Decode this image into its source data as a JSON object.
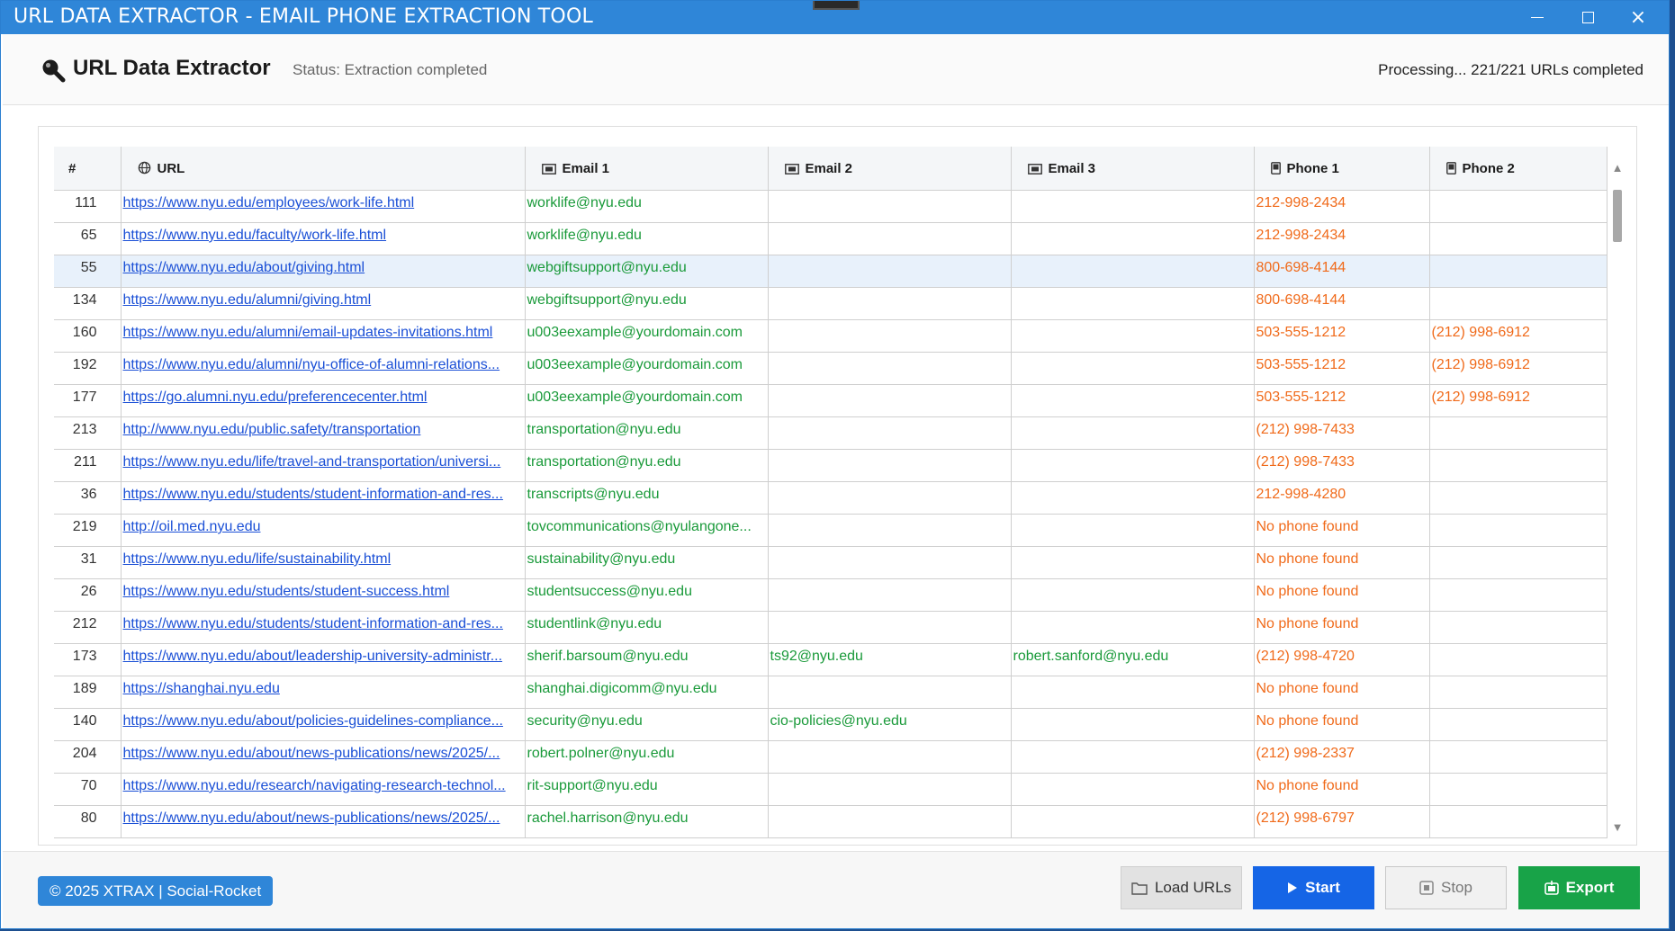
{
  "window": {
    "title": "URL DATA EXTRACTOR - EMAIL  PHONE EXTRACTION TOOL"
  },
  "header": {
    "app_name": "URL Data Extractor",
    "status": "Status: Extraction completed",
    "progress": "Processing... 221/221 URLs completed"
  },
  "table": {
    "columns": [
      "#",
      "URL",
      "Email 1",
      "Email 2",
      "Email 3",
      "Phone 1",
      "Phone 2"
    ],
    "rows": [
      {
        "num": "111",
        "url": "https://www.nyu.edu/employees/work-life.html",
        "email1": "worklife@nyu.edu",
        "email2": "",
        "email3": "",
        "phone1": "212-998-2434",
        "phone2": ""
      },
      {
        "num": "65",
        "url": "https://www.nyu.edu/faculty/work-life.html",
        "email1": "worklife@nyu.edu",
        "email2": "",
        "email3": "",
        "phone1": "212-998-2434",
        "phone2": ""
      },
      {
        "num": "55",
        "url": "https://www.nyu.edu/about/giving.html",
        "email1": "webgiftsupport@nyu.edu",
        "email2": "",
        "email3": "",
        "phone1": "800-698-4144",
        "phone2": ""
      },
      {
        "num": "134",
        "url": "https://www.nyu.edu/alumni/giving.html",
        "email1": "webgiftsupport@nyu.edu",
        "email2": "",
        "email3": "",
        "phone1": "800-698-4144",
        "phone2": ""
      },
      {
        "num": "160",
        "url": "https://www.nyu.edu/alumni/email-updates-invitations.html",
        "email1": "u003eexample@yourdomain.com",
        "email2": "",
        "email3": "",
        "phone1": "503-555-1212",
        "phone2": "(212) 998-6912"
      },
      {
        "num": "192",
        "url": "https://www.nyu.edu/alumni/nyu-office-of-alumni-relations...",
        "email1": "u003eexample@yourdomain.com",
        "email2": "",
        "email3": "",
        "phone1": "503-555-1212",
        "phone2": "(212) 998-6912"
      },
      {
        "num": "177",
        "url": "https://go.alumni.nyu.edu/preferencecenter.html",
        "email1": "u003eexample@yourdomain.com",
        "email2": "",
        "email3": "",
        "phone1": "503-555-1212",
        "phone2": "(212) 998-6912"
      },
      {
        "num": "213",
        "url": "http://www.nyu.edu/public.safety/transportation",
        "email1": "transportation@nyu.edu",
        "email2": "",
        "email3": "",
        "phone1": "(212) 998-7433",
        "phone2": ""
      },
      {
        "num": "211",
        "url": "https://www.nyu.edu/life/travel-and-transportation/universi...",
        "email1": "transportation@nyu.edu",
        "email2": "",
        "email3": "",
        "phone1": "(212) 998-7433",
        "phone2": ""
      },
      {
        "num": "36",
        "url": "https://www.nyu.edu/students/student-information-and-res...",
        "email1": "transcripts@nyu.edu",
        "email2": "",
        "email3": "",
        "phone1": "212-998-4280",
        "phone2": ""
      },
      {
        "num": "219",
        "url": "http://oil.med.nyu.edu",
        "email1": "tovcommunications@nyulangone...",
        "email2": "",
        "email3": "",
        "phone1": "No phone found",
        "phone2": ""
      },
      {
        "num": "31",
        "url": "https://www.nyu.edu/life/sustainability.html",
        "email1": "sustainability@nyu.edu",
        "email2": "",
        "email3": "",
        "phone1": "No phone found",
        "phone2": ""
      },
      {
        "num": "26",
        "url": "https://www.nyu.edu/students/student-success.html",
        "email1": "studentsuccess@nyu.edu",
        "email2": "",
        "email3": "",
        "phone1": "No phone found",
        "phone2": ""
      },
      {
        "num": "212",
        "url": "https://www.nyu.edu/students/student-information-and-res...",
        "email1": "studentlink@nyu.edu",
        "email2": "",
        "email3": "",
        "phone1": "No phone found",
        "phone2": ""
      },
      {
        "num": "173",
        "url": "https://www.nyu.edu/about/leadership-university-administr...",
        "email1": "sherif.barsoum@nyu.edu",
        "email2": "ts92@nyu.edu",
        "email3": "robert.sanford@nyu.edu",
        "phone1": "(212) 998-4720",
        "phone2": ""
      },
      {
        "num": "189",
        "url": "https://shanghai.nyu.edu",
        "email1": "shanghai.digicomm@nyu.edu",
        "email2": "",
        "email3": "",
        "phone1": "No phone found",
        "phone2": ""
      },
      {
        "num": "140",
        "url": "https://www.nyu.edu/about/policies-guidelines-compliance...",
        "email1": "security@nyu.edu",
        "email2": "cio-policies@nyu.edu",
        "email3": "",
        "phone1": "No phone found",
        "phone2": ""
      },
      {
        "num": "204",
        "url": "https://www.nyu.edu/about/news-publications/news/2025/...",
        "email1": "robert.polner@nyu.edu",
        "email2": "",
        "email3": "",
        "phone1": "(212) 998-2337",
        "phone2": ""
      },
      {
        "num": "70",
        "url": "https://www.nyu.edu/research/navigating-research-technol...",
        "email1": "rit-support@nyu.edu",
        "email2": "",
        "email3": "",
        "phone1": "No phone found",
        "phone2": ""
      },
      {
        "num": "80",
        "url": "https://www.nyu.edu/about/news-publications/news/2025/...",
        "email1": "rachel.harrison@nyu.edu",
        "email2": "",
        "email3": "",
        "phone1": "(212) 998-6797",
        "phone2": ""
      }
    ],
    "selected_row": 2
  },
  "footer": {
    "copyright": "© 2025 XTRAX | Social-Rocket",
    "load_label": "Load URLs",
    "start_label": "Start",
    "stop_label": "Stop",
    "export_label": "Export"
  },
  "colors": {
    "titlebar": "#2f86d8",
    "url": "#1a4fd6",
    "email": "#1a9a3a",
    "phone": "#f06a1a",
    "start": "#1565e6",
    "export": "#18a348"
  }
}
